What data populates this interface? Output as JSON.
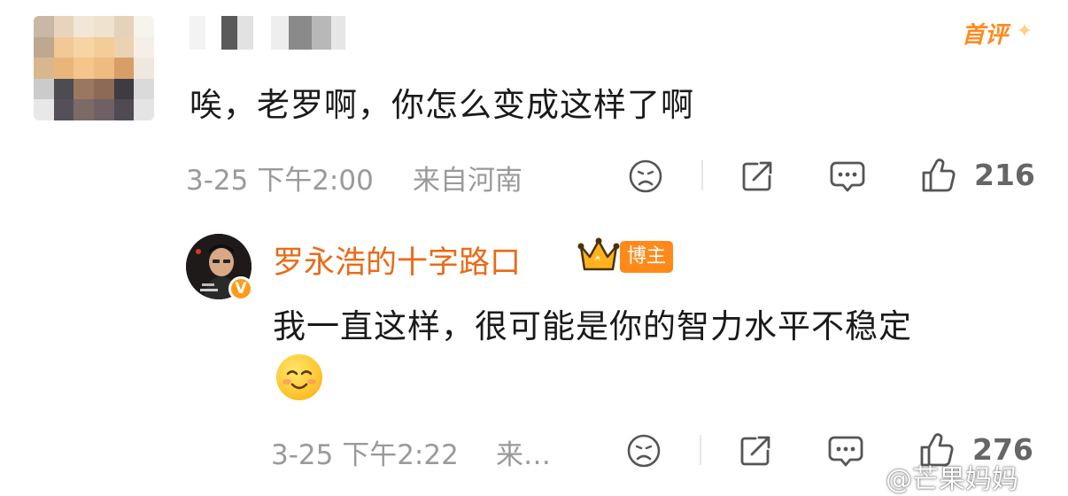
{
  "comments": [
    {
      "text": "唉，老罗啊，你怎么变成这样了啊",
      "time": "3-25 下午2:00",
      "location": "来自河南",
      "likes": "216",
      "badge": "首评"
    }
  ],
  "reply": {
    "author": "罗永浩的十字路口",
    "tag": "博主",
    "text": "我一直这样，很可能是你的智力水平不稳定",
    "time": "3-25 下午2:22",
    "location": "来…",
    "likes": "276"
  },
  "watermark": "@芒果妈妈",
  "colors": {
    "accent": "#ea6a16",
    "meta": "#9a9a9a",
    "badge": "#ff8a1a"
  }
}
